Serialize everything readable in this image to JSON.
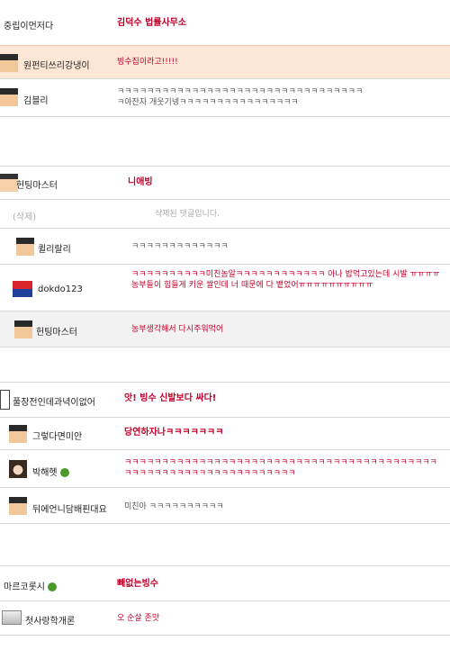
{
  "comments": [
    {
      "nick": "중립이먼저다",
      "text": "김덕수 법률사무소"
    },
    {
      "nick": "원펀티쓰리강냉이",
      "text": "빙수집이라고!!!!!"
    },
    {
      "nick": "김블리",
      "text": "ㅋㅋㅋㅋㅋㅋㅋㅋㅋㅋㅋㅋㅋㅋㅋㅋㅋㅋㅋㅋㅋㅋㅋㅋㅋㅋㅋㅋㅋㅋㅋㅋㅋ\nㅋ아잔자 개웃기넹ㅋㅋㅋㅋㅋㅋㅋㅋㅋㅋㅋㅋㅋㅋㅋㅋ"
    },
    {
      "nick": "헌팅마스터",
      "text": "니애빙"
    },
    {
      "nick": "(삭제)",
      "text": "삭제된 댓글입니다."
    },
    {
      "nick": "퀼리랄리",
      "text": "ㅋㅋㅋㅋㅋㅋㅋㅋㅋㅋㅋㅋㅋ"
    },
    {
      "nick": "dokdo123",
      "text": "ㅋㅋㅋㅋㅋㅋㅋㅋㅋㅋ미친놈알ㅋㅋㅋㅋㅋㅋㅋㅋㅋㅋㅋㅋ 아나 밥먹고있는데 시발 ㅠㅠㅠㅠ농부들이 힘들게 키운 쌀인데 너 때문에 다 뱉었어ㅠㅠㅠㅠㅠㅠㅠㅠㅠㅠ"
    },
    {
      "nick": "헌팅마스터",
      "text": "농부생각해서 다시주워먹어"
    },
    {
      "nick": "풀장전인데과녁이없어",
      "text": "앗! 빙수 신발보다 싸다!"
    },
    {
      "nick": "그렇다면미안",
      "text": "당연하자나ㅋㅋㅋㅋㅋㅋㅋ"
    },
    {
      "nick": "박해헷",
      "text": "ㅋㅋㅋㅋㅋㅋㅋㅋㅋㅋㅋㅋㅋㅋㅋㅋㅋㅋㅋㅋㅋㅋㅋㅋㅋㅋㅋㅋㅋㅋㅋㅋㅋㅋㅋㅋㅋㅋㅋㅋㅋㅋㅋㅋㅋㅋㅋㅋㅋㅋㅋㅋㅋㅋㅋㅋㅋㅋㅋㅋㅋㅋㅋㅋㅋ"
    },
    {
      "nick": "뒤에언니담배핀대요",
      "text": "미친아 ㅋㅋㅋㅋㅋㅋㅋㅋㅋㅋ"
    },
    {
      "nick": "마르코롯시",
      "text": "빼없는빙수"
    },
    {
      "nick": "첫사랑학개론",
      "text": "오 순살 존맛"
    }
  ]
}
